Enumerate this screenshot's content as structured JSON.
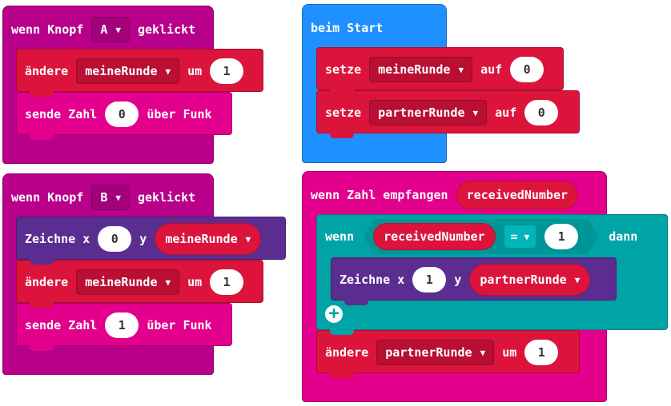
{
  "colors": {
    "input": "#b8008a",
    "input_dark": "#a3007b",
    "variables": "#dc143c",
    "variables_dark": "#b80f33",
    "radio": "#e3008c",
    "radio_dark": "#c1007a",
    "basic": "#1e90ff",
    "led": "#5c2d91",
    "logic": "#00a4a6"
  },
  "block_a": {
    "hat": {
      "prefix": "wenn Knopf",
      "button": "A",
      "suffix": "geklickt"
    },
    "change": {
      "label": "ändere",
      "variable": "meineRunde",
      "by": "um",
      "value": "1"
    },
    "send": {
      "label": "sende Zahl",
      "value": "0",
      "suffix": "über Funk"
    }
  },
  "block_b": {
    "hat": {
      "prefix": "wenn Knopf",
      "button": "B",
      "suffix": "geklickt"
    },
    "plot": {
      "label": "Zeichne x",
      "x": "0",
      "y_label": "y",
      "y_var": "meineRunde"
    },
    "change": {
      "label": "ändere",
      "variable": "meineRunde",
      "by": "um",
      "value": "1"
    },
    "send": {
      "label": "sende Zahl",
      "value": "1",
      "suffix": "über Funk"
    }
  },
  "block_start": {
    "hat": {
      "label": "beim Start"
    },
    "set1": {
      "label": "setze",
      "variable": "meineRunde",
      "to": "auf",
      "value": "0"
    },
    "set2": {
      "label": "setze",
      "variable": "partnerRunde",
      "to": "auf",
      "value": "0"
    }
  },
  "block_receive": {
    "hat": {
      "label": "wenn Zahl empfangen",
      "param": "receivedNumber"
    },
    "if": {
      "label": "wenn",
      "left": "receivedNumber",
      "op": "=",
      "right": "1",
      "then": "dann"
    },
    "plot": {
      "label": "Zeichne x",
      "x": "1",
      "y_label": "y",
      "y_var": "partnerRunde"
    },
    "change": {
      "label": "ändere",
      "variable": "partnerRunde",
      "by": "um",
      "value": "1"
    }
  }
}
